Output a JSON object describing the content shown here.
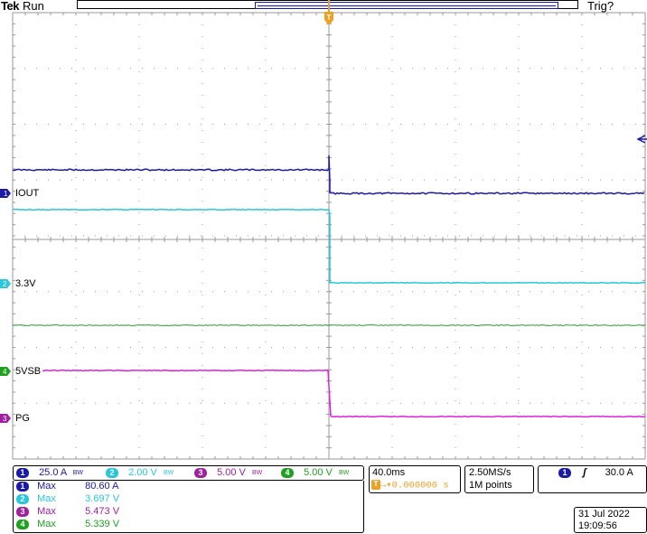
{
  "header": {
    "brand": "Tek",
    "run_state": "Run",
    "trigger_state": "Trig?"
  },
  "colors": {
    "ch1": "#1a1aa8",
    "ch2": "#28c8dc",
    "ch3": "#a020a0",
    "ch4": "#20a020",
    "ch3_trace": "#e020e0",
    "trigger": "#f0a020",
    "grid": "#9a9a9a"
  },
  "channel_labels": {
    "ch1": "IOUT",
    "ch2": "3.3V",
    "ch3": "5VSB",
    "ch4": "PG"
  },
  "channel_markers": {
    "ch1": "1",
    "ch2": "2",
    "ch3": "3",
    "ch4": "4"
  },
  "scales": [
    {
      "channel": "1",
      "value": "25.0 A",
      "bw_icon": "bandwidth-limit-icon"
    },
    {
      "channel": "2",
      "value": "2.00 V",
      "bw_icon": "bandwidth-limit-icon"
    },
    {
      "channel": "3",
      "value": "5.00 V",
      "bw_icon": "bandwidth-limit-icon"
    },
    {
      "channel": "4",
      "value": "5.00 V",
      "bw_icon": "bandwidth-limit-icon"
    }
  ],
  "bw_glyph": "BW",
  "timebase": {
    "time_per_div": "40.0ms",
    "trigger_position": "0.000000 s",
    "trigger_icon": "T"
  },
  "acquisition": {
    "sample_rate": "2.50MS/s",
    "record_length": "1M points"
  },
  "trigger": {
    "source": "1",
    "slope_icon": "rising-edge-icon",
    "slope_glyph": "ʃ",
    "level": "30.0 A",
    "marker_label": "T"
  },
  "measurements": [
    {
      "channel": "1",
      "type": "Max",
      "value": "80.60 A"
    },
    {
      "channel": "2",
      "type": "Max",
      "value": "3.697 V"
    },
    {
      "channel": "3",
      "type": "Max",
      "value": "5.473 V"
    },
    {
      "channel": "4",
      "type": "Max",
      "value": "5.339 V"
    }
  ],
  "datetime": {
    "date": "31 Jul  2022",
    "time": "19:09:56"
  }
}
